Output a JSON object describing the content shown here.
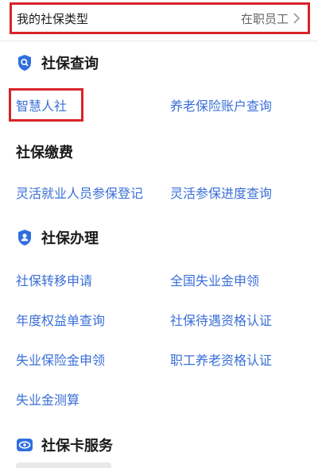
{
  "social_security_type": {
    "label": "我的社保类型",
    "value": "在职员工"
  },
  "sections": {
    "query": {
      "title": "社保查询",
      "icon": "search-shield-icon",
      "items": [
        "智慧人社",
        "养老保险账户查询"
      ]
    },
    "payment": {
      "title": "社保缴费",
      "items": [
        "灵活就业人员参保登记",
        "灵活参保进度查询"
      ]
    },
    "handle": {
      "title": "社保办理",
      "icon": "person-shield-icon",
      "items": [
        "社保转移申请",
        "全国失业金申领",
        "年度权益单查询",
        "社保待遇资格认证",
        "失业保险金申领",
        "职工养老资格认证",
        "失业金测算"
      ]
    },
    "card": {
      "title": "社保卡服务",
      "icon": "eye-card-icon"
    }
  },
  "colors": {
    "accent_blue": "#3a6fd8",
    "highlight_red": "#d9232a",
    "icon_blue": "#2f6fe0"
  }
}
